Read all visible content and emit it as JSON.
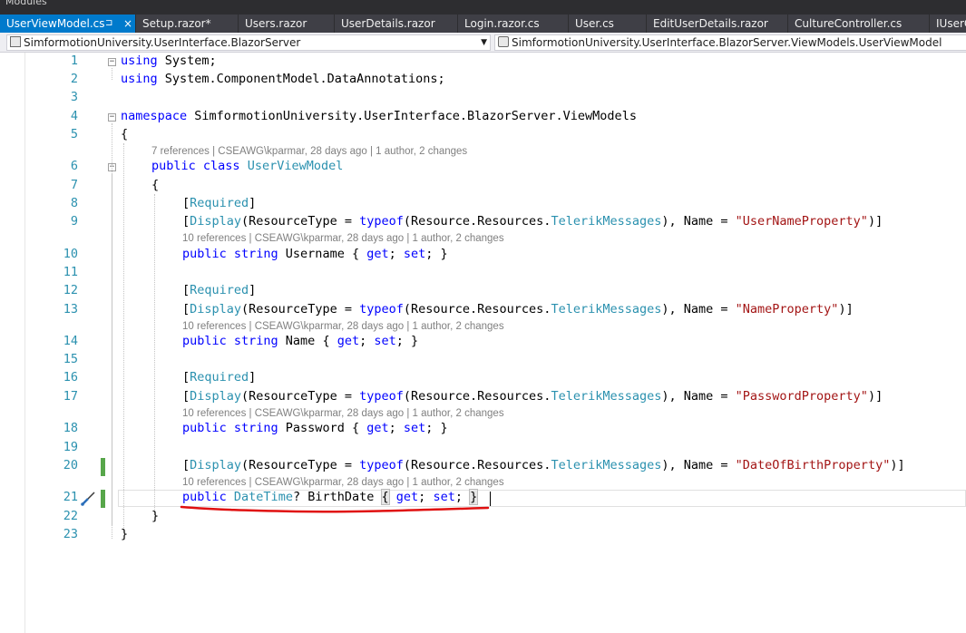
{
  "top_strip": "Modules",
  "tabs": [
    {
      "label": "UserViewModel.cs",
      "active": true,
      "pin": "⊐",
      "close": "×"
    },
    {
      "label": "Setup.razor*"
    },
    {
      "label": "Users.razor"
    },
    {
      "label": "UserDetails.razor"
    },
    {
      "label": "Login.razor.cs"
    },
    {
      "label": "User.cs"
    },
    {
      "label": "EditUserDetails.razor"
    },
    {
      "label": "CultureController.cs"
    },
    {
      "label": "IUserQ"
    }
  ],
  "navbar": {
    "project": "SimformotionUniversity.UserInterface.BlazorServer",
    "type": "SimformotionUniversity.UserInterface.BlazorServer.ViewModels.UserViewModel"
  },
  "lens": {
    "class": "7 references | CSEAWG\\kparmar, 28 days ago | 1 author, 2 changes",
    "prop": "10 references | CSEAWG\\kparmar, 28 days ago | 1 author, 2 changes"
  },
  "line_numbers": [
    "1",
    "2",
    "3",
    "4",
    "5",
    "6",
    "7",
    "8",
    "9",
    "10",
    "11",
    "12",
    "13",
    "14",
    "15",
    "16",
    "17",
    "18",
    "19",
    "20",
    "21",
    "22",
    "23"
  ],
  "code": {
    "l1_kw": "using",
    "l1_rest": " System;",
    "l2_kw": "using",
    "l2_rest": " System.ComponentModel.DataAnnotations;",
    "l4_kw": "namespace",
    "l4_rest": " SimformotionUniversity.UserInterface.BlazorServer.ViewModels",
    "open_brace": "{",
    "close_brace": "}",
    "l6_kw": "public class",
    "l6_type": "UserViewModel",
    "required": "Required",
    "display": "Display",
    "rt": "(ResourceType = ",
    "typeof": "typeof",
    "res": "(Resource.Resources.",
    "tm": "TelerikMessages",
    "name_eq": "), Name = ",
    "end": ")]",
    "str_username": "\"UserNameProperty\"",
    "str_name": "\"NameProperty\"",
    "str_password": "\"PasswordProperty\"",
    "str_dob": "\"DateOfBirthProperty\"",
    "public_string": "public string",
    "public": "public",
    "get": "get",
    "set": "set",
    "username": " Username { ",
    "name": " Name { ",
    "password": " Password { ",
    "datetime": "DateTime",
    "birthdate": "? BirthDate ",
    "get_sep": "; ",
    "set_end": "; }"
  },
  "colors": {
    "keyword": "#0000ff",
    "type": "#2b91af",
    "string": "#a31515",
    "annotation_underline": "#e01010",
    "active_tab": "#007acc"
  }
}
